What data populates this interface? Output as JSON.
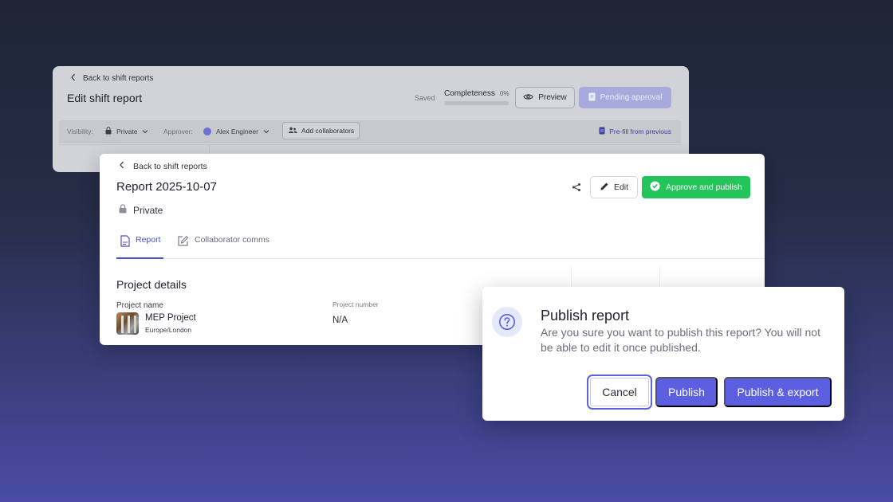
{
  "colors": {
    "accent": "#5b5fe0",
    "approve_green": "#23c55a",
    "dialog_icon_bg": "#e6e8fb"
  },
  "back_card": {
    "back_link": "Back to shift reports",
    "title": "Edit shift report",
    "saved": "Saved",
    "completeness_label": "Completeness",
    "completeness_value": "0%",
    "completeness_fraction": 0,
    "preview_label": "Preview",
    "pending_label": "Pending approval",
    "visibility_label": "Visibility:",
    "visibility_value": "Private",
    "approver_label": "Approver:",
    "approver_value": "Alex Engineer",
    "add_collaborators": "Add collaborators",
    "prefill": "Pre-fill from previous"
  },
  "main_card": {
    "back_link": "Back to shift reports",
    "title": "Report 2025-10-07",
    "privacy": "Private",
    "edit_label": "Edit",
    "approve_label": "Approve and publish",
    "tabs": [
      {
        "label": "Report",
        "active": true,
        "icon": "document-icon"
      },
      {
        "label": "Collaborator comms",
        "active": false,
        "icon": "pencil-square-icon"
      }
    ],
    "section_title": "Project details",
    "project_name_label": "Project name",
    "project_name": "MEP Project",
    "timezone": "Europe/London",
    "project_number_label": "Project number",
    "project_number": "N/A"
  },
  "dialog": {
    "icon": "question-circle-icon",
    "title": "Publish report",
    "message": "Are you sure you want to publish this report? You will not be able to edit it once published.",
    "cancel_label": "Cancel",
    "publish_label": "Publish",
    "export_label": "Publish & export"
  }
}
